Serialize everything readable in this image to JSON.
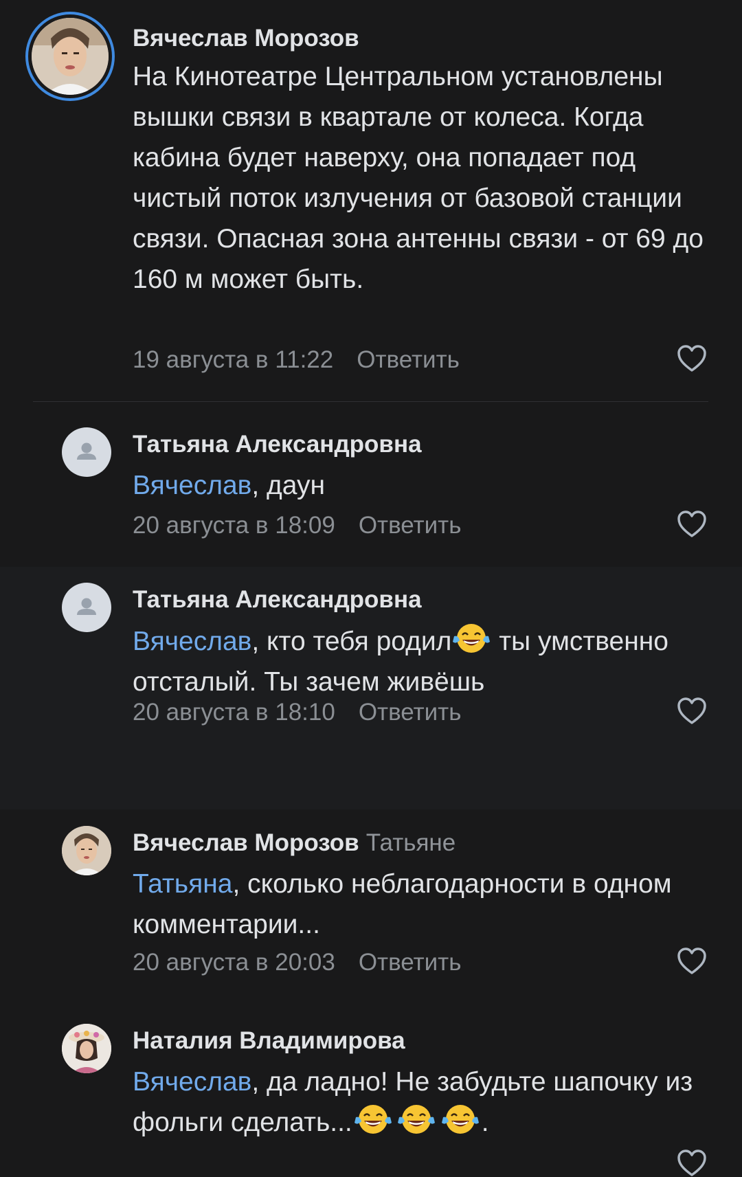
{
  "comments": [
    {
      "author": "Вячеслав Морозов",
      "reply_to": "",
      "mention": "",
      "text": "На Кинотеатре Центральном установлены вышки связи в квартале от колеса. Когда кабина будет наверху, она попадает под чистый поток излучения от базовой станции связи. Опасная зона антенны связи - от 69 до 160 м может быть.",
      "date": "19 августа в 11:22",
      "reply_label": "Ответить"
    },
    {
      "author": "Татьяна Александровна",
      "mention": "Вячеслав",
      "text": ",  даун",
      "date": "20 августа в 18:09",
      "reply_label": "Ответить"
    },
    {
      "author": "Татьяна Александровна",
      "mention": "Вячеслав",
      "text_a": ", кто тебя родил",
      "text_b": " ты умственно отсталый. Ты зачем живёшь",
      "date": "20 августа в 18:10",
      "reply_label": "Ответить"
    },
    {
      "author": "Вячеслав Морозов",
      "reply_to": "Татьяне",
      "mention": "Татьяна",
      "text": ", сколько неблагодарности в одном комментарии...",
      "date": "20 августа в 20:03",
      "reply_label": "Ответить"
    },
    {
      "author": "Наталия Владимирова",
      "mention": "Вячеслав",
      "text_a": ", да ладно! Не забудьте шапочку из фольги сделать...",
      "text_b": ".",
      "date": "",
      "reply_label": ""
    }
  ],
  "icons": {
    "like": "heart-outline-icon",
    "emoji": "face-with-tears-of-joy-icon",
    "placeholder_avatar": "user-placeholder-icon"
  },
  "colors": {
    "background": "#19191a",
    "mention": "#71aaeb",
    "story_ring": "#3f8ae0",
    "meta": "#8b8f94"
  }
}
